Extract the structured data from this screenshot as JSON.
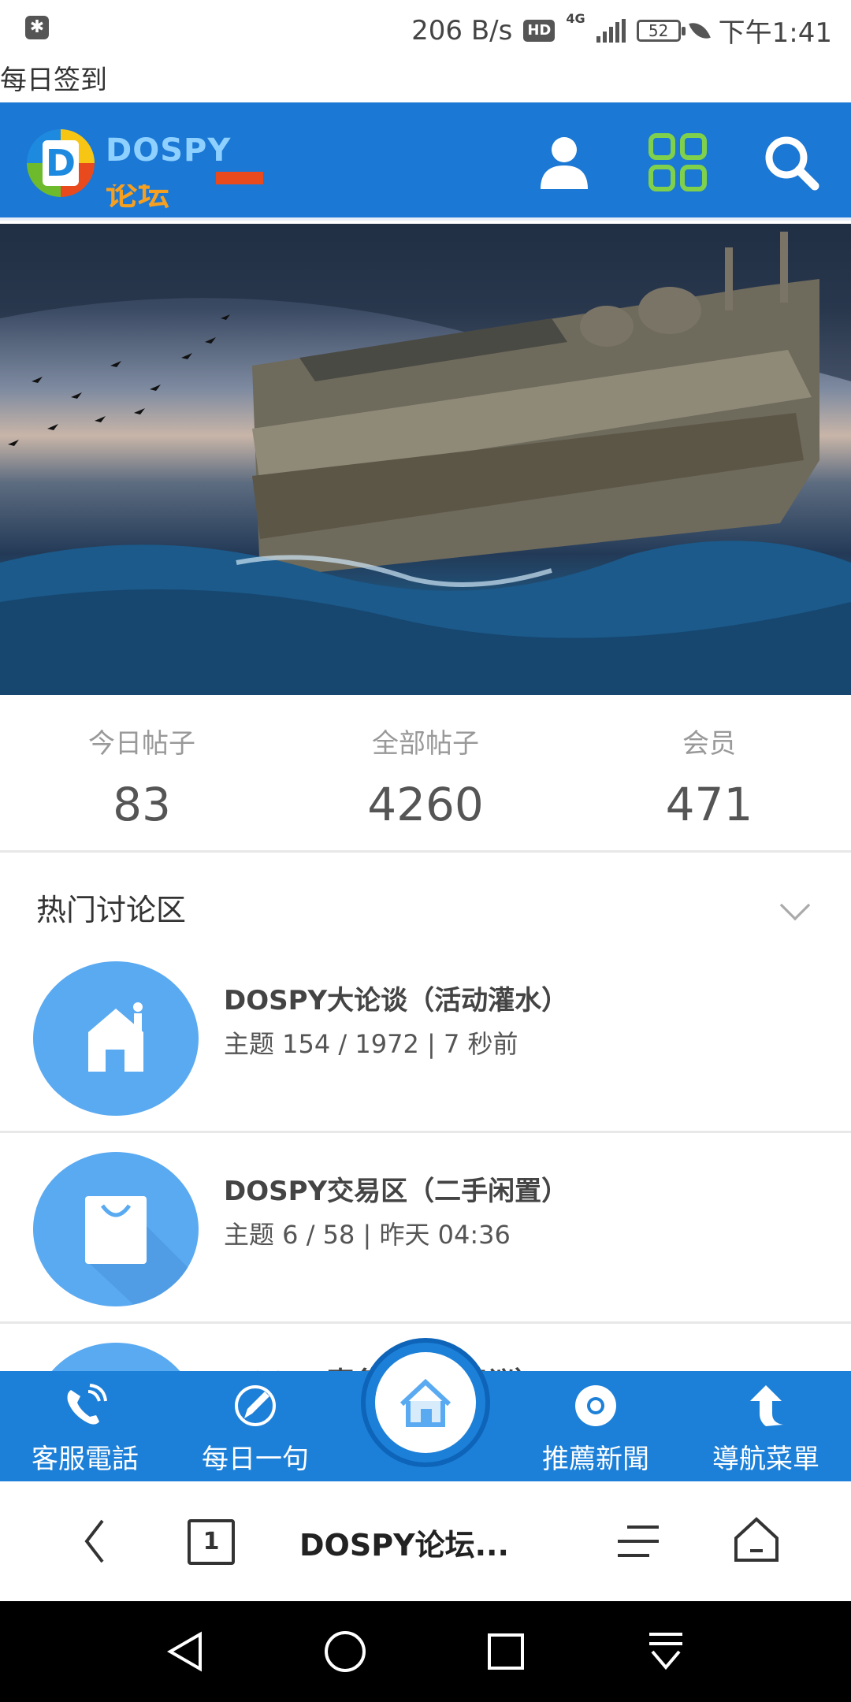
{
  "status_bar": {
    "speed": "206 B/s",
    "hd": "HD",
    "network": "4G",
    "battery": "52",
    "time": "下午1:41"
  },
  "page_title": "每日签到",
  "header": {
    "logo_text": "DOSPY",
    "logo_text_cn": "论坛",
    "logo_letter": "D",
    "icons": [
      "user-icon",
      "apps-grid-icon",
      "search-icon"
    ]
  },
  "stats": [
    {
      "label": "今日帖子",
      "value": "83"
    },
    {
      "label": "全部帖子",
      "value": "4260"
    },
    {
      "label": "会员",
      "value": "471"
    }
  ],
  "section": {
    "title": "热门讨论区"
  },
  "forums": [
    {
      "title": "DOSPY大论谈（活动灌水）",
      "meta": "主题 154 / 1972 | 7 秒前",
      "icon": "home-icon"
    },
    {
      "title": "DOSPY交易区（二手闲置）",
      "meta": "主题 6 / 58 | 昨天 04:36",
      "icon": "shopping-bag-icon"
    },
    {
      "title": "DOSPY事务与站务建议）",
      "meta": "",
      "icon": "forum-icon"
    }
  ],
  "bottom_nav": [
    {
      "label": "客服電話",
      "icon": "phone-icon"
    },
    {
      "label": "每日一句",
      "icon": "pen-icon"
    },
    {
      "label": "",
      "icon": "home-icon"
    },
    {
      "label": "推薦新聞",
      "icon": "chrome-icon"
    },
    {
      "label": "導航菜單",
      "icon": "arrow-up-icon"
    }
  ],
  "browser_bar": {
    "tab_count": "1",
    "title": "DOSPY论坛..."
  },
  "colors": {
    "primary": "#1b78d4",
    "nav": "#1d80d8",
    "forum_icon": "#5aaaf2"
  }
}
